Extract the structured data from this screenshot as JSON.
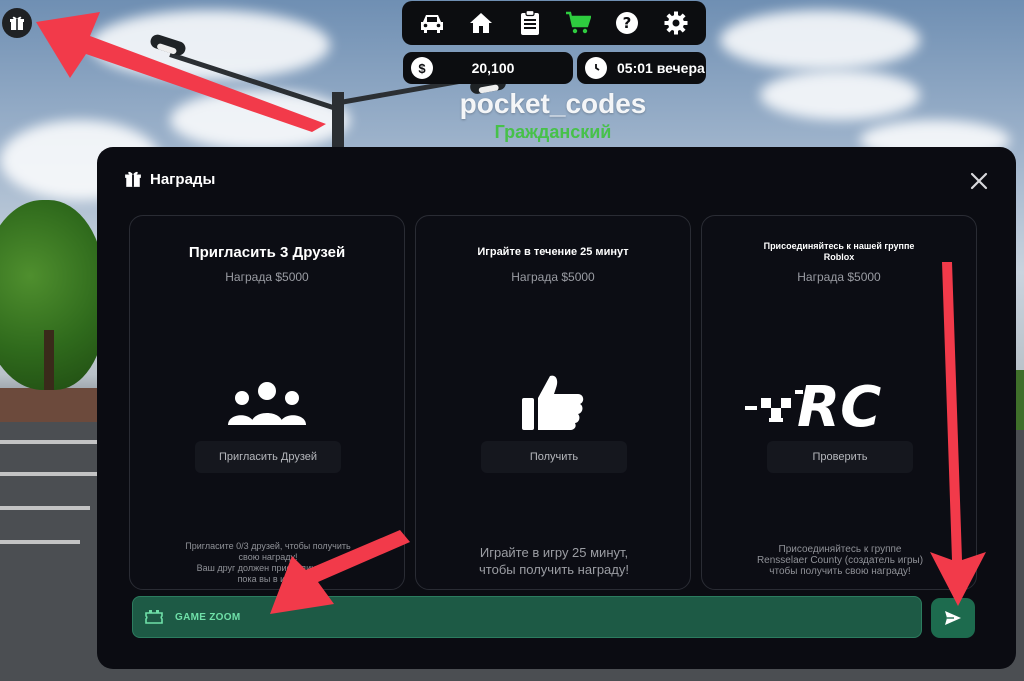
{
  "hud": {
    "menu_icons": [
      "car-icon",
      "home-icon",
      "clipboard-icon",
      "shop-cart-icon",
      "help-icon",
      "gear-icon"
    ],
    "money": "20,100",
    "money_icon": "dollar-icon",
    "time": "05:01 вечера",
    "time_icon": "clock-icon",
    "username": "pocket_codes",
    "role": "Гражданский"
  },
  "rewards": {
    "title": "Награды",
    "cards": [
      {
        "title": "Пригласить 3 Друзей",
        "reward": "Награда $5000",
        "icon": "users-group-icon",
        "button": "Пригласить Друзей",
        "desc_line1": "Пригласите 0/3 друзей, чтобы получить",
        "desc_line2": "свою награду!",
        "desc_line3": "Ваш друг должен присоединиться",
        "desc_line4": "пока вы в игре"
      },
      {
        "title": "Играйте в течение 25 минут",
        "reward": "Награда $5000",
        "icon": "thumbs-up-icon",
        "button": "Получить",
        "desc_line1": "Играйте в игру 25 минут,",
        "desc_line2": "чтобы получить награду!"
      },
      {
        "title_line1": "Присоединяйтесь к нашей группе",
        "title_line2": "Roblox",
        "reward": "Награда $5000",
        "icon": "rc-logo",
        "logo_text": "RC",
        "button": "Проверить",
        "desc_line1": "Присоединяйтесь к группе",
        "desc_line2": "Rensselaer County (создатель игры)",
        "desc_line3": "чтобы получить свою награду!"
      }
    ],
    "code_input": {
      "value": "GAME ZOOM",
      "icon": "ticket-icon"
    },
    "send_icon": "send-icon"
  },
  "colors": {
    "panel": "#0b0c12",
    "accent_green": "#1d5a45",
    "role_green": "#47c14a",
    "annotation_red": "#f23a4a"
  }
}
